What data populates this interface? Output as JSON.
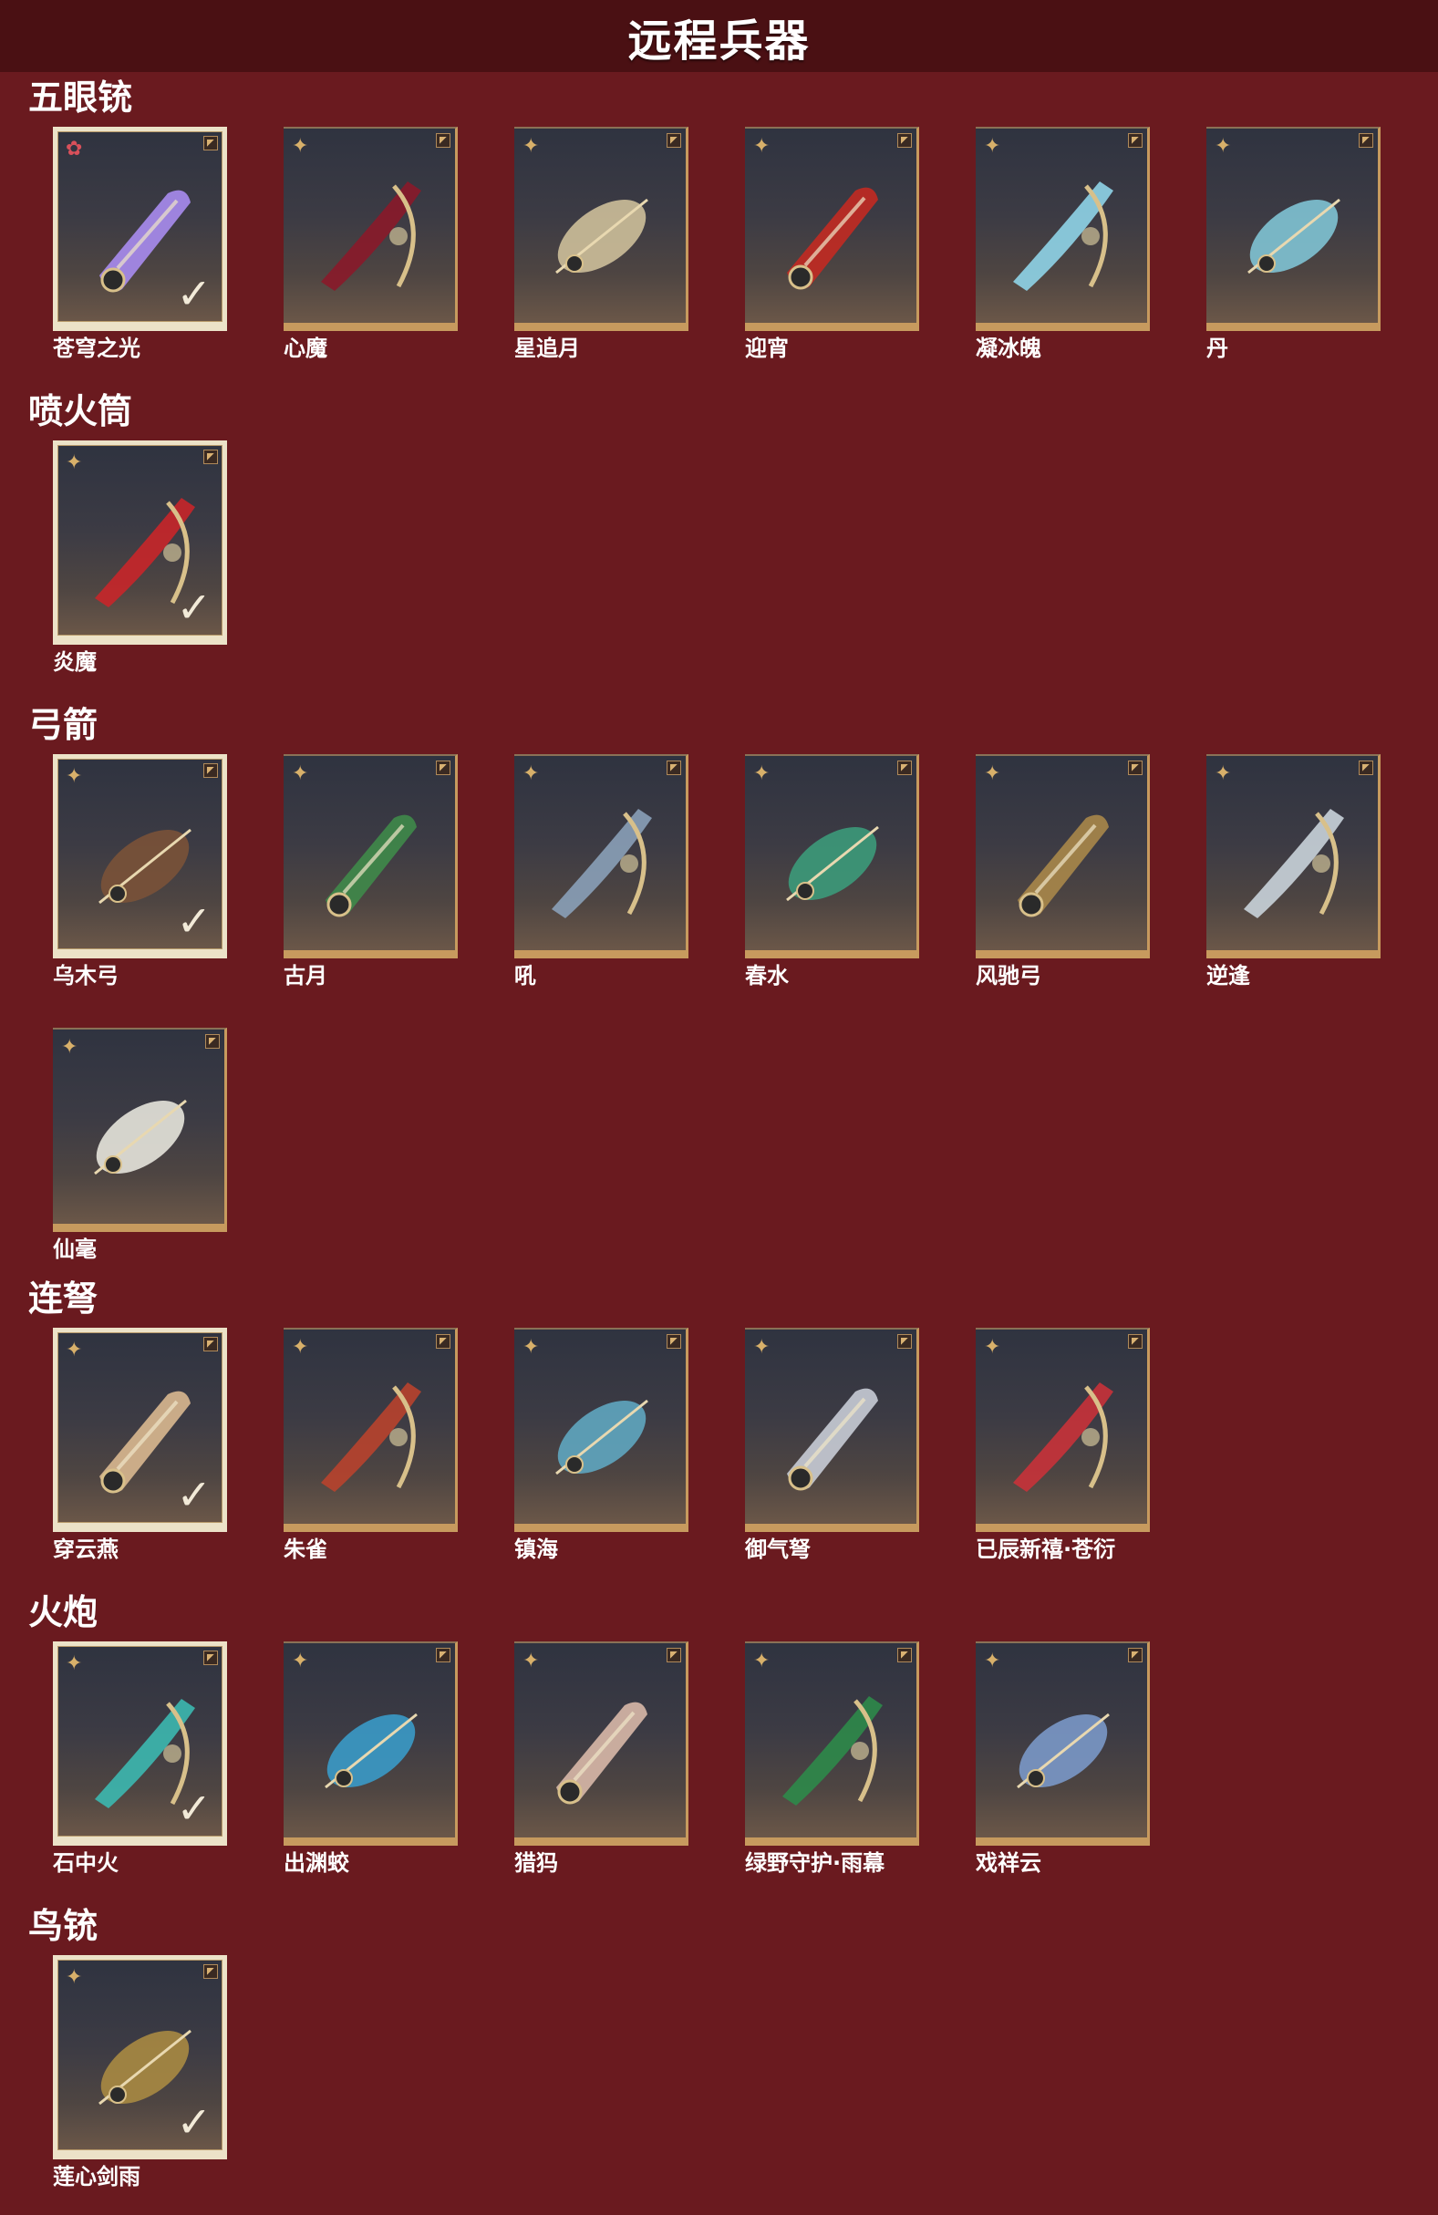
{
  "header": {
    "title": "远程兵器"
  },
  "sections": [
    {
      "title": "五眼铳",
      "items": [
        {
          "name": "苍穹之光",
          "owned": true,
          "rarity": "red",
          "color": "#a88cf0"
        },
        {
          "name": "心魔",
          "owned": false,
          "rarity": "gold",
          "color": "#8a1a2a"
        },
        {
          "name": "星追月",
          "owned": false,
          "rarity": "gold",
          "color": "#cdbf9a"
        },
        {
          "name": "迎宵",
          "owned": false,
          "rarity": "gold",
          "color": "#c22a22"
        },
        {
          "name": "凝冰魄",
          "owned": false,
          "rarity": "gold",
          "color": "#8fd4e8"
        },
        {
          "name": "丹",
          "owned": false,
          "rarity": "gold",
          "color": "#7fc3d4"
        }
      ]
    },
    {
      "title": "喷火筒",
      "items": [
        {
          "name": "炎魔",
          "owned": true,
          "rarity": "gold",
          "color": "#c8262a"
        }
      ]
    },
    {
      "title": "弓箭",
      "items": [
        {
          "name": "乌木弓",
          "owned": true,
          "rarity": "gold",
          "color": "#7a5238"
        },
        {
          "name": "古月",
          "owned": false,
          "rarity": "gold",
          "color": "#3f8a4a"
        },
        {
          "name": "吼",
          "owned": false,
          "rarity": "gold",
          "color": "#8aa0b8"
        },
        {
          "name": "春水",
          "owned": false,
          "rarity": "gold",
          "color": "#3c9a7a"
        },
        {
          "name": "风驰弓",
          "owned": false,
          "rarity": "gold",
          "color": "#a8874a"
        },
        {
          "name": "逆逢",
          "owned": false,
          "rarity": "gold",
          "color": "#c9d3da"
        },
        {
          "name": "仙毫",
          "owned": false,
          "rarity": "gold",
          "color": "#e6e4dc"
        }
      ]
    },
    {
      "title": "连弩",
      "items": [
        {
          "name": "穿云燕",
          "owned": true,
          "rarity": "gold",
          "color": "#d9b890"
        },
        {
          "name": "朱雀",
          "owned": false,
          "rarity": "gold",
          "color": "#b8422e"
        },
        {
          "name": "镇海",
          "owned": false,
          "rarity": "gold",
          "color": "#5fa6c0"
        },
        {
          "name": "御气弩",
          "owned": false,
          "rarity": "gold",
          "color": "#c8ccd6"
        },
        {
          "name": "已辰新禧·苍衍",
          "owned": false,
          "rarity": "gold",
          "color": "#c8323a"
        }
      ]
    },
    {
      "title": "火炮",
      "items": [
        {
          "name": "石中火",
          "owned": true,
          "rarity": "gold",
          "color": "#3cb8b0"
        },
        {
          "name": "出渊蛟",
          "owned": false,
          "rarity": "gold",
          "color": "#3a9ac8"
        },
        {
          "name": "猎犸",
          "owned": false,
          "rarity": "gold",
          "color": "#d8b8a8"
        },
        {
          "name": "绿野守护·雨幕",
          "owned": false,
          "rarity": "gold",
          "color": "#2e8a4a"
        },
        {
          "name": "戏祥云",
          "owned": false,
          "rarity": "gold",
          "color": "#7a98c8"
        }
      ]
    },
    {
      "title": "鸟铳",
      "items": [
        {
          "name": "莲心剑雨",
          "owned": true,
          "rarity": "gold",
          "color": "#a88a42"
        }
      ]
    }
  ],
  "icons": {
    "rarity_gold": "four-point-star-icon",
    "rarity_red": "flower-icon",
    "owned": "checkmark-icon",
    "corner": "corner-tab-icon"
  }
}
